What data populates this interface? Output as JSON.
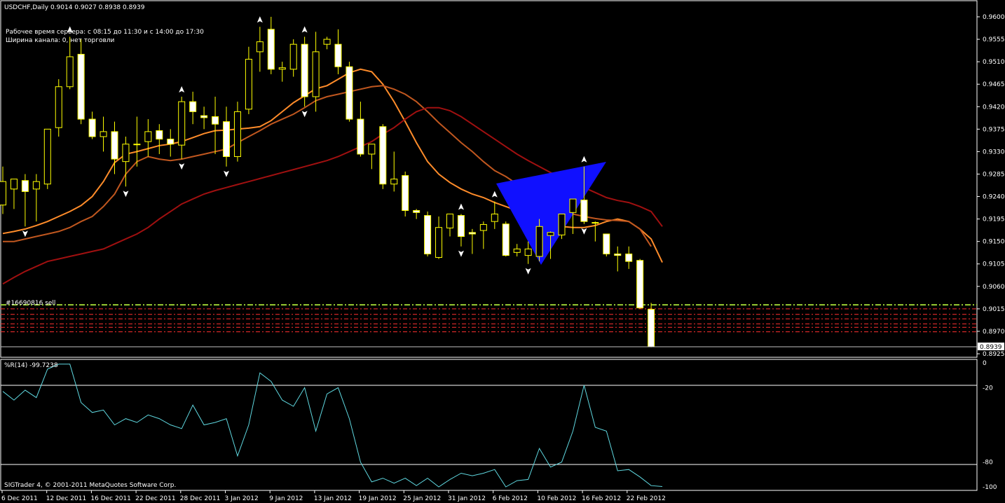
{
  "header": {
    "symbol_line": "USDCHF,Daily  0.9014 0.9027 0.8938 0.8939",
    "server_time": "Рабочее время сервера: с 08:15 до 11:30 и с 14:00 до 17:30",
    "channel_width": "Ширина канала: 0, нет торговли"
  },
  "order_label": "#16690816 sell",
  "price_tag": "0.8939",
  "indicator_label": "%R(14) -99.7238",
  "copyright": "SIGTrader 4, © 2001-2011 MetaQuotes Software Corp.",
  "colors": {
    "background": "#000000",
    "bull_candle": "#000000",
    "bear_candle": "#ffffff",
    "wick": "#ffff00",
    "ma_fast": "#ff8c2a",
    "ma_mid": "#c0571f",
    "ma_slow": "#a01010",
    "wpr": "#5fd8e0",
    "triangle": "#1010ff",
    "order_line": "#9acd32",
    "level_lines": "#ff3030"
  },
  "chart_data": {
    "type": "candlestick",
    "title": "USDCHF,Daily",
    "price_axis_ticks": [
      "0.9600",
      "0.9555",
      "0.9510",
      "0.9465",
      "0.9420",
      "0.9375",
      "0.9330",
      "0.9285",
      "0.9240",
      "0.9195",
      "0.9150",
      "0.9105",
      "0.9060",
      "0.9015",
      "0.8970",
      "0.8925"
    ],
    "ylim": [
      0.8915,
      0.962
    ],
    "date_axis_ticks": [
      "6 Dec 2011",
      "12 Dec 2011",
      "16 Dec 2011",
      "22 Dec 2011",
      "28 Dec 2011",
      "3 Jan 2012",
      "9 Jan 2012",
      "13 Jan 2012",
      "19 Jan 2012",
      "25 Jan 2012",
      "31 Jan 2012",
      "6 Feb 2012",
      "10 Feb 2012",
      "16 Feb 2012",
      "22 Feb 2012"
    ],
    "candles": [
      {
        "o": 0.9223,
        "h": 0.93,
        "l": 0.9205,
        "c": 0.927
      },
      {
        "o": 0.9255,
        "h": 0.927,
        "l": 0.9215,
        "c": 0.9275
      },
      {
        "o": 0.9272,
        "h": 0.9285,
        "l": 0.918,
        "c": 0.925
      },
      {
        "o": 0.9255,
        "h": 0.9285,
        "l": 0.919,
        "c": 0.927
      },
      {
        "o": 0.9265,
        "h": 0.933,
        "l": 0.9255,
        "c": 0.9375
      },
      {
        "o": 0.9378,
        "h": 0.9475,
        "l": 0.936,
        "c": 0.946
      },
      {
        "o": 0.946,
        "h": 0.956,
        "l": 0.9455,
        "c": 0.952
      },
      {
        "o": 0.9525,
        "h": 0.9555,
        "l": 0.9385,
        "c": 0.9395
      },
      {
        "o": 0.9395,
        "h": 0.941,
        "l": 0.9355,
        "c": 0.936
      },
      {
        "o": 0.936,
        "h": 0.94,
        "l": 0.933,
        "c": 0.937
      },
      {
        "o": 0.937,
        "h": 0.939,
        "l": 0.9285,
        "c": 0.9315
      },
      {
        "o": 0.931,
        "h": 0.936,
        "l": 0.926,
        "c": 0.9345
      },
      {
        "o": 0.9345,
        "h": 0.94,
        "l": 0.93,
        "c": 0.9345
      },
      {
        "o": 0.935,
        "h": 0.9395,
        "l": 0.932,
        "c": 0.937
      },
      {
        "o": 0.9372,
        "h": 0.9385,
        "l": 0.9325,
        "c": 0.9355
      },
      {
        "o": 0.9355,
        "h": 0.9375,
        "l": 0.932,
        "c": 0.9345
      },
      {
        "o": 0.9343,
        "h": 0.944,
        "l": 0.9315,
        "c": 0.943
      },
      {
        "o": 0.943,
        "h": 0.945,
        "l": 0.9385,
        "c": 0.941
      },
      {
        "o": 0.9402,
        "h": 0.942,
        "l": 0.9375,
        "c": 0.9398
      },
      {
        "o": 0.94,
        "h": 0.944,
        "l": 0.9325,
        "c": 0.9385
      },
      {
        "o": 0.939,
        "h": 0.942,
        "l": 0.93,
        "c": 0.932
      },
      {
        "o": 0.932,
        "h": 0.943,
        "l": 0.931,
        "c": 0.941
      },
      {
        "o": 0.9415,
        "h": 0.954,
        "l": 0.9405,
        "c": 0.9515
      },
      {
        "o": 0.953,
        "h": 0.958,
        "l": 0.949,
        "c": 0.955
      },
      {
        "o": 0.9575,
        "h": 0.96,
        "l": 0.9485,
        "c": 0.9495
      },
      {
        "o": 0.9495,
        "h": 0.951,
        "l": 0.947,
        "c": 0.9498
      },
      {
        "o": 0.9495,
        "h": 0.9555,
        "l": 0.948,
        "c": 0.9545
      },
      {
        "o": 0.9545,
        "h": 0.956,
        "l": 0.942,
        "c": 0.944
      },
      {
        "o": 0.944,
        "h": 0.957,
        "l": 0.941,
        "c": 0.953
      },
      {
        "o": 0.9545,
        "h": 0.956,
        "l": 0.9535,
        "c": 0.9555
      },
      {
        "o": 0.9545,
        "h": 0.9575,
        "l": 0.9485,
        "c": 0.95
      },
      {
        "o": 0.95,
        "h": 0.951,
        "l": 0.939,
        "c": 0.9395
      },
      {
        "o": 0.9395,
        "h": 0.943,
        "l": 0.932,
        "c": 0.9325
      },
      {
        "o": 0.9325,
        "h": 0.934,
        "l": 0.9295,
        "c": 0.9345
      },
      {
        "o": 0.938,
        "h": 0.9385,
        "l": 0.9255,
        "c": 0.9265
      },
      {
        "o": 0.9265,
        "h": 0.933,
        "l": 0.925,
        "c": 0.9275
      },
      {
        "o": 0.9282,
        "h": 0.929,
        "l": 0.92,
        "c": 0.9212
      },
      {
        "o": 0.9212,
        "h": 0.9215,
        "l": 0.9195,
        "c": 0.9208
      },
      {
        "o": 0.9202,
        "h": 0.921,
        "l": 0.912,
        "c": 0.9125
      },
      {
        "o": 0.9118,
        "h": 0.92,
        "l": 0.9115,
        "c": 0.9178
      },
      {
        "o": 0.9177,
        "h": 0.9205,
        "l": 0.916,
        "c": 0.9205
      },
      {
        "o": 0.9202,
        "h": 0.9205,
        "l": 0.914,
        "c": 0.916
      },
      {
        "o": 0.9168,
        "h": 0.9175,
        "l": 0.9125,
        "c": 0.9165
      },
      {
        "o": 0.9172,
        "h": 0.919,
        "l": 0.9135,
        "c": 0.9184
      },
      {
        "o": 0.919,
        "h": 0.923,
        "l": 0.9175,
        "c": 0.9205
      },
      {
        "o": 0.9185,
        "h": 0.919,
        "l": 0.912,
        "c": 0.9122
      },
      {
        "o": 0.9128,
        "h": 0.9145,
        "l": 0.912,
        "c": 0.9135
      },
      {
        "o": 0.9122,
        "h": 0.915,
        "l": 0.9105,
        "c": 0.9135
      },
      {
        "o": 0.912,
        "h": 0.9195,
        "l": 0.911,
        "c": 0.918
      },
      {
        "o": 0.9162,
        "h": 0.917,
        "l": 0.9115,
        "c": 0.9168
      },
      {
        "o": 0.9163,
        "h": 0.9205,
        "l": 0.9155,
        "c": 0.9205
      },
      {
        "o": 0.9208,
        "h": 0.9235,
        "l": 0.9165,
        "c": 0.9235
      },
      {
        "o": 0.9233,
        "h": 0.93,
        "l": 0.9185,
        "c": 0.919
      },
      {
        "o": 0.9187,
        "h": 0.919,
        "l": 0.915,
        "c": 0.9188
      },
      {
        "o": 0.9165,
        "h": 0.9165,
        "l": 0.912,
        "c": 0.9125
      },
      {
        "o": 0.9125,
        "h": 0.914,
        "l": 0.909,
        "c": 0.9122
      },
      {
        "o": 0.9125,
        "h": 0.914,
        "l": 0.9095,
        "c": 0.911
      },
      {
        "o": 0.9112,
        "h": 0.9115,
        "l": 0.9015,
        "c": 0.9017
      },
      {
        "o": 0.9014,
        "h": 0.9027,
        "l": 0.8938,
        "c": 0.8939
      }
    ],
    "series": [
      {
        "values": [
          0.9166,
          0.917,
          0.9175,
          0.9182,
          0.919,
          0.92,
          0.921,
          0.9222,
          0.924,
          0.927,
          0.9308,
          0.9325,
          0.933,
          0.9336,
          0.9342,
          0.9345,
          0.935,
          0.9358,
          0.9366,
          0.9372,
          0.9373,
          0.9375,
          0.9377,
          0.938,
          0.9392,
          0.941,
          0.9428,
          0.9442,
          0.9456,
          0.9462,
          0.9475,
          0.9488,
          0.9495,
          0.949,
          0.9465,
          0.943,
          0.939,
          0.9348,
          0.931,
          0.9285,
          0.9268,
          0.9255,
          0.9245,
          0.9238,
          0.9228,
          0.922,
          0.9212,
          0.9202,
          0.9195,
          0.9185,
          0.918,
          0.9178,
          0.9178,
          0.9182,
          0.919,
          0.9195,
          0.919,
          0.9175,
          0.9155,
          0.9108
        ]
      },
      {
        "values": [
          0.915,
          0.915,
          0.9155,
          0.916,
          0.9165,
          0.917,
          0.9178,
          0.919,
          0.92,
          0.922,
          0.9245,
          0.9285,
          0.931,
          0.932,
          0.9315,
          0.9312,
          0.9315,
          0.932,
          0.9325,
          0.933,
          0.9335,
          0.9348,
          0.936,
          0.9372,
          0.9385,
          0.9395,
          0.9405,
          0.9418,
          0.9432,
          0.944,
          0.9445,
          0.945,
          0.9455,
          0.946,
          0.9462,
          0.9455,
          0.9445,
          0.943,
          0.941,
          0.9388,
          0.9368,
          0.9348,
          0.933,
          0.931,
          0.9292,
          0.928,
          0.9265,
          0.925,
          0.9235,
          0.9222,
          0.9212,
          0.9205,
          0.92,
          0.9196,
          0.9193,
          0.9192,
          0.919,
          0.9175,
          0.914
        ]
      },
      {
        "values": [
          0.9065,
          0.9078,
          0.909,
          0.91,
          0.911,
          0.9115,
          0.912,
          0.9125,
          0.913,
          0.9135,
          0.9145,
          0.9155,
          0.9165,
          0.9178,
          0.9195,
          0.921,
          0.9225,
          0.9235,
          0.9245,
          0.9252,
          0.9258,
          0.9264,
          0.927,
          0.9276,
          0.9282,
          0.9288,
          0.9294,
          0.93,
          0.9306,
          0.9312,
          0.932,
          0.933,
          0.934,
          0.935,
          0.9365,
          0.9378,
          0.9395,
          0.941,
          0.9418,
          0.9418,
          0.9412,
          0.94,
          0.9385,
          0.937,
          0.9355,
          0.934,
          0.9325,
          0.9312,
          0.93,
          0.9288,
          0.9278,
          0.9268,
          0.9258,
          0.9248,
          0.9238,
          0.9232,
          0.9228,
          0.922,
          0.921,
          0.918
        ]
      }
    ],
    "wpr_axis_ticks": [
      "0",
      "-20",
      "-80",
      "-100"
    ],
    "wpr_ylim": [
      -100,
      0
    ],
    "wpr_values": [
      -23,
      -30,
      -22,
      -28,
      -5,
      -1,
      -1,
      -32,
      -40,
      -38,
      -50,
      -45,
      -48,
      -42,
      -45,
      -50,
      -53,
      -34,
      -50,
      -48,
      -45,
      -75,
      -50,
      -8,
      -15,
      -30,
      -35,
      -20,
      -55,
      -25,
      -20,
      -45,
      -80,
      -96,
      -93,
      -97,
      -93,
      -99,
      -93,
      -100,
      -94,
      -89,
      -91,
      -89,
      -86,
      -100,
      -95,
      -94,
      -69,
      -84,
      -80,
      -55,
      -18,
      -52,
      -55,
      -87,
      -86,
      -92,
      -99,
      -99.7
    ],
    "lower_levels": [
      0.9015,
      0.9004,
      0.8995,
      0.8985,
      0.8978,
      0.8969
    ]
  }
}
